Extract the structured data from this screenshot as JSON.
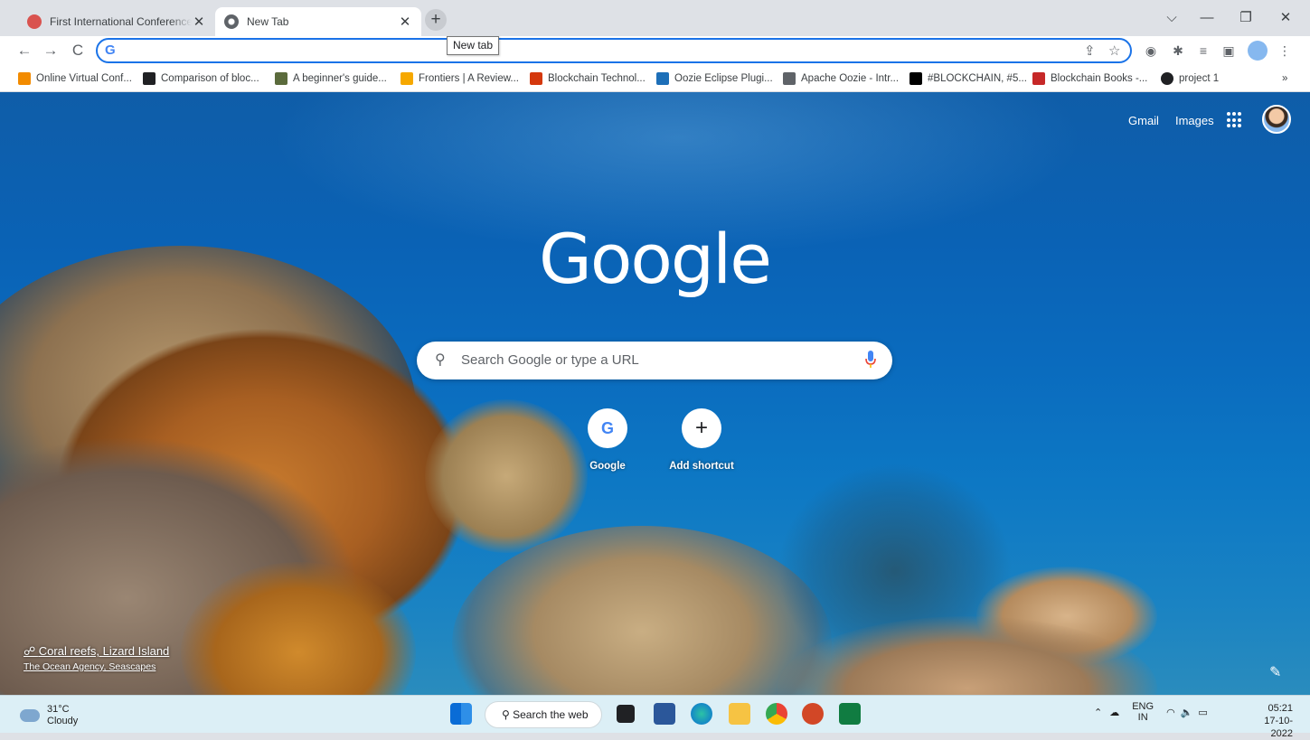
{
  "tabs": [
    {
      "title": "First International Conference on",
      "active": false
    },
    {
      "title": "New Tab",
      "active": true
    }
  ],
  "tooltip": "New tab",
  "window_controls": {
    "chevron": "⌵",
    "minimize": "—",
    "restore": "❐",
    "close": "✕"
  },
  "toolbar": {
    "back": "←",
    "forward": "→",
    "reload": "C",
    "omnibox_icon": "G"
  },
  "bookmarks": [
    {
      "label": "Online Virtual Conf...",
      "color": "#f28b00"
    },
    {
      "label": "Comparison of bloc...",
      "color": "#202124"
    },
    {
      "label": "A beginner's guide...",
      "color": "#5b6b3c"
    },
    {
      "label": "Frontiers | A Review...",
      "color": "#f6a800"
    },
    {
      "label": "Blockchain Technol...",
      "color": "#d4380d"
    },
    {
      "label": "Oozie Eclipse Plugi...",
      "color": "#1d6fb8"
    },
    {
      "label": "Apache Oozie - Intr...",
      "color": "#5f6368"
    },
    {
      "label": "#BLOCKCHAIN, #5...",
      "color": "#000000"
    },
    {
      "label": "Blockchain Books -...",
      "color": "#c62828"
    },
    {
      "label": "project 1",
      "color": "#202124"
    }
  ],
  "bookmarks_overflow": "»",
  "header_links": {
    "gmail": "Gmail",
    "images": "Images"
  },
  "logo": "Google",
  "search": {
    "placeholder": "Search Google or type a URL"
  },
  "shortcuts": [
    {
      "label": "Google",
      "icon": "G"
    },
    {
      "label": "Add shortcut",
      "icon": "+"
    }
  ],
  "attribution": {
    "title": "Coral reefs, Lizard Island",
    "credit": "The Ocean Agency, Seascapes"
  },
  "taskbar": {
    "weather_temp": "31°C",
    "weather_desc": "Cloudy",
    "search_label": "Search the web",
    "lang_top": "ENG",
    "lang_bottom": "IN",
    "time": "05:21",
    "date": "17-10-2022"
  }
}
